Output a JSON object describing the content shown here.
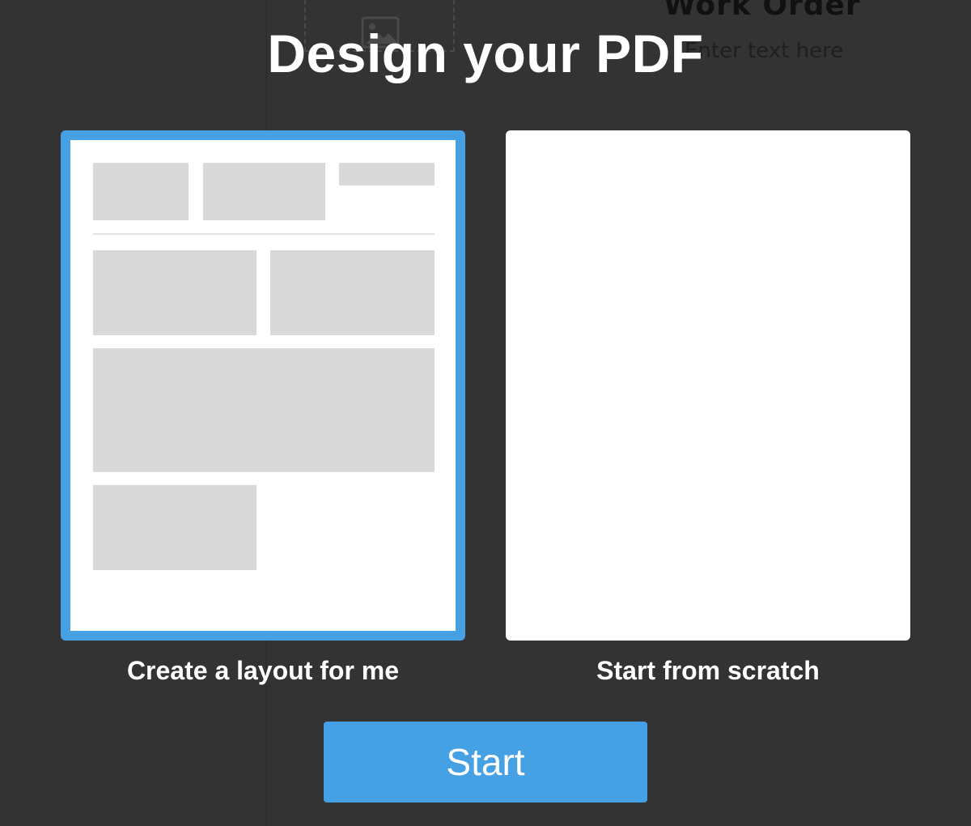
{
  "background": {
    "heading": "Work Order",
    "placeholder_text": "Enter text here"
  },
  "modal": {
    "title": "Design your PDF",
    "options": [
      {
        "label": "Create a layout for me",
        "selected": true
      },
      {
        "label": "Start from scratch",
        "selected": false
      }
    ],
    "start_label": "Start"
  },
  "colors": {
    "overlay": "#333333",
    "accent": "#46a0e4",
    "placeholder_block": "#d9d9d9",
    "text": "#ffffff"
  },
  "icons": {
    "background_image": "image-icon"
  }
}
